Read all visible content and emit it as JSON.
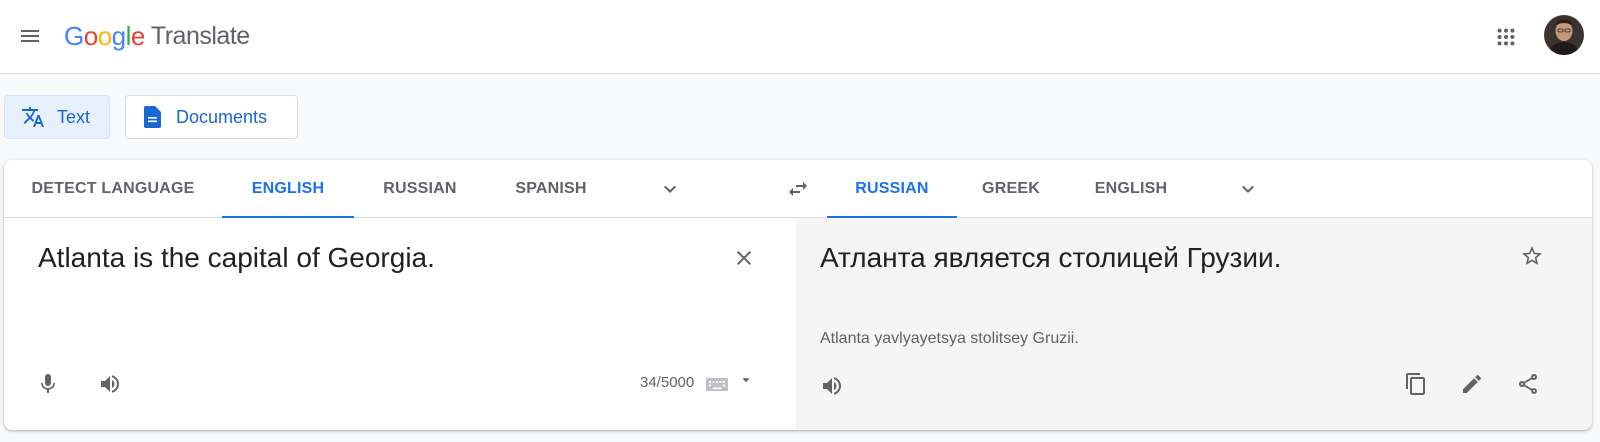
{
  "header": {
    "logo_letters": [
      {
        "ch": "G",
        "color": "#4285F4"
      },
      {
        "ch": "o",
        "color": "#EA4335"
      },
      {
        "ch": "o",
        "color": "#FBBC05"
      },
      {
        "ch": "g",
        "color": "#4285F4"
      },
      {
        "ch": "l",
        "color": "#34A853"
      },
      {
        "ch": "e",
        "color": "#EA4335"
      }
    ],
    "product_name": "Translate",
    "icons": {
      "menu": "hamburger-menu-icon",
      "apps": "apps-grid-icon",
      "avatar": "user-avatar"
    }
  },
  "modes": [
    {
      "label": "Text",
      "icon": "translate-icon",
      "selected": true
    },
    {
      "label": "Documents",
      "icon": "document-icon",
      "selected": false
    }
  ],
  "source": {
    "tabs": [
      "DETECT LANGUAGE",
      "ENGLISH",
      "RUSSIAN",
      "SPANISH"
    ],
    "active_tab": "ENGLISH",
    "text": "Atlanta is the capital of Georgia.",
    "char_count": "34/5000"
  },
  "target": {
    "tabs": [
      "RUSSIAN",
      "GREEK",
      "ENGLISH"
    ],
    "active_tab": "RUSSIAN",
    "text": "Атланта является столицей Грузии.",
    "transliteration": "Atlanta yavlyayetsya stolitsey Gruzii."
  },
  "colors": {
    "accent": "#1a73e8",
    "accent_dark": "#1967d2",
    "selected_bg": "#e8f0fe",
    "icon_gray": "#5f6368",
    "target_bg": "#f5f5f5"
  }
}
